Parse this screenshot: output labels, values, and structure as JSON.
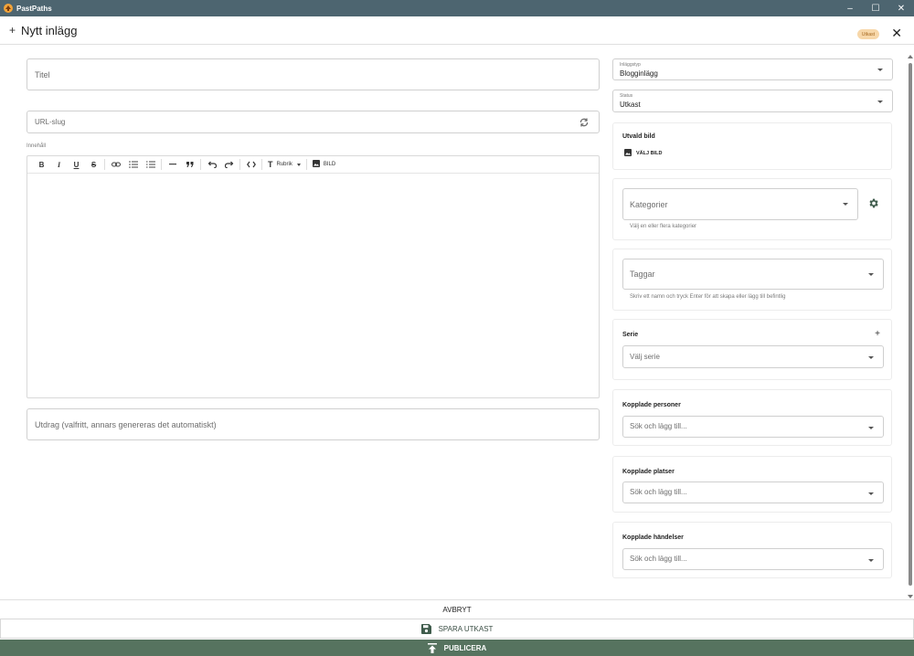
{
  "window": {
    "app_name": "PastPaths",
    "minimize": "–",
    "maximize": "☐",
    "close": "✕"
  },
  "header": {
    "plus": "+",
    "title": "Nytt inlägg",
    "status_badge": "Utkast",
    "close": "✕"
  },
  "main": {
    "title_placeholder": "Titel",
    "slug_placeholder": "URL-slug",
    "content_label": "Innehåll",
    "toolbar": {
      "bold": "B",
      "italic": "I",
      "underline": "U",
      "strike": "S",
      "heading_label": "Rubrik",
      "image_label": "BILD"
    },
    "excerpt_placeholder": "Utdrag (valfritt, annars genereras det automatiskt)"
  },
  "sidebar": {
    "post_type": {
      "label": "Inläggstyp",
      "value": "Blogginlägg"
    },
    "status": {
      "label": "Status",
      "value": "Utkast"
    },
    "featured_image": {
      "title": "Utvald bild",
      "button": "VÄLJ BILD"
    },
    "categories": {
      "placeholder": "Kategorier",
      "hint": "Välj en eller flera kategorier"
    },
    "tags": {
      "placeholder": "Taggar",
      "hint": "Skriv ett namn och tryck Enter för att skapa eller lägg till befintlig"
    },
    "series": {
      "title": "Serie",
      "add": "+",
      "placeholder": "Välj serie"
    },
    "linked_people": {
      "title": "Kopplade personer",
      "placeholder": "Sök och lägg till..."
    },
    "linked_places": {
      "title": "Kopplade platser",
      "placeholder": "Sök och lägg till..."
    },
    "linked_events": {
      "title": "Kopplade händelser",
      "placeholder": "Sök och lägg till..."
    }
  },
  "footer": {
    "cancel": "AVBRYT",
    "save_draft": "SPARA UTKAST",
    "publish": "PUBLICERA"
  },
  "colors": {
    "titlebar": "#4d6570",
    "publish": "#56735f",
    "badge_bg": "#f7d7a9",
    "badge_text": "#a5671e",
    "accent": "#3f5c4c"
  }
}
